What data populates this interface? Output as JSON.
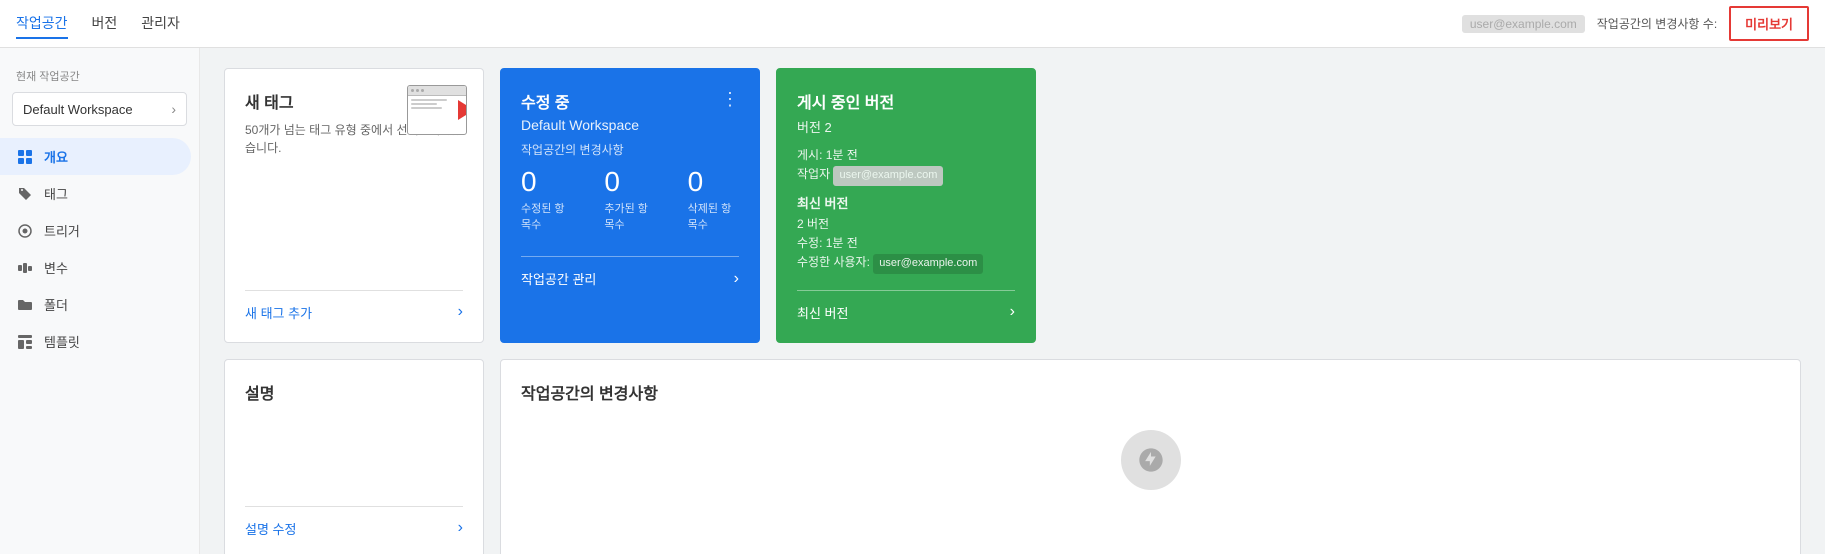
{
  "topNav": {
    "items": [
      "작업공간",
      "버전",
      "관리자"
    ],
    "activeItem": "작업공간",
    "userInfo": "user@example.com",
    "workspaceChangeText": "작업공간의 변경사항 수:",
    "previewLabel": "미리보기"
  },
  "sidebar": {
    "currentWorkspaceLabel": "현재 작업공간",
    "workspaceName": "Default Workspace",
    "items": [
      {
        "id": "overview",
        "label": "개요",
        "icon": "grid"
      },
      {
        "id": "tags",
        "label": "태그",
        "icon": "tag"
      },
      {
        "id": "triggers",
        "label": "트리거",
        "icon": "trigger"
      },
      {
        "id": "variables",
        "label": "변수",
        "icon": "variable"
      },
      {
        "id": "folders",
        "label": "폴더",
        "icon": "folder"
      },
      {
        "id": "templates",
        "label": "템플릿",
        "icon": "template"
      }
    ],
    "activeItem": "overview"
  },
  "main": {
    "newTagCard": {
      "title": "새 태그",
      "description": "50개가 넘는 태그 유형 중에서 선택할 수 있습니다.",
      "linkLabel": "새 태그 추가"
    },
    "editingCard": {
      "title": "수정 중",
      "workspaceName": "Default Workspace",
      "dotsLabel": "⋮"
    },
    "changesCard": {
      "label": "작업공간의 변경사항",
      "stats": [
        {
          "value": "0",
          "desc": "수정된 항목수"
        },
        {
          "value": "0",
          "desc": "추가된 항목수"
        },
        {
          "value": "0",
          "desc": "삭제된 항목수"
        }
      ],
      "linkLabel": "작업공간 관리"
    },
    "publishedCard": {
      "title": "게시 중인 버전",
      "version": "버전 2",
      "publishedTime": "게시: 1분 전",
      "authorLabel": "작업자",
      "authorValue": "user@example.com",
      "latestVersionTitle": "최신 버전",
      "latestVersionDesc": "2 버전",
      "latestModified": "수정: 1분 전",
      "latestUserLabel": "수정한 사용자:",
      "latestUserValue": "user@example.com",
      "linkLabel": "최신 버전"
    },
    "descriptionCard": {
      "title": "설명",
      "linkLabel": "설명 수정"
    },
    "bottomCard": {
      "title": "작업공간의 변경사항"
    }
  }
}
